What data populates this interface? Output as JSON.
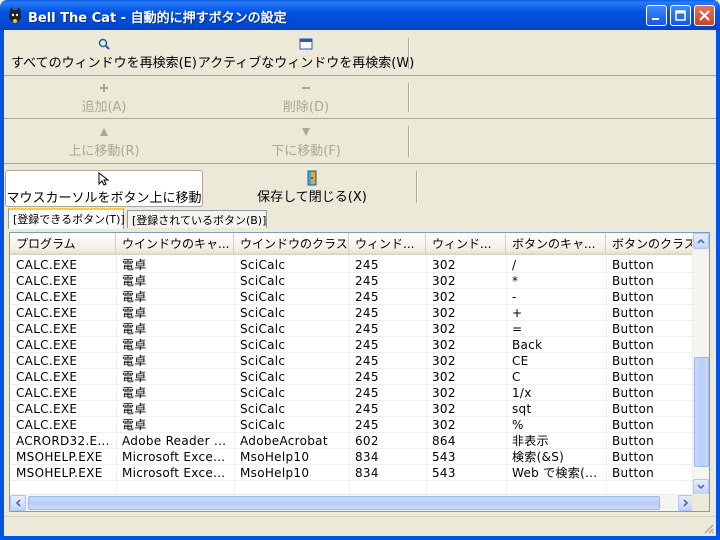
{
  "window": {
    "title": "Bell The Cat - 自動的に押すボタンの設定"
  },
  "toolbar": {
    "row1": {
      "search_all_label": "すべてのウィンドウを再検索(E)",
      "search_active_label": "アクティブなウィンドウを再検索(W)"
    },
    "row2": {
      "add_label": "追加(A)",
      "delete_label": "削除(D)"
    },
    "row3": {
      "move_up_label": "上に移動(R)",
      "move_down_label": "下に移動(F)"
    },
    "row4": {
      "move_cursor_label": "マウスカーソルをボタン上に移動",
      "save_close_label": "保存して閉じる(X)"
    }
  },
  "tabs": [
    {
      "label": "[登録できるボタン(T)]",
      "active": true
    },
    {
      "label": "[登録されているボタン(B)]",
      "active": false
    }
  ],
  "table": {
    "columns": [
      "プログラム",
      "ウインドウのキャ...",
      "ウインドウのクラス",
      "ウィンド...",
      "ウィンド...",
      "ボタンのキャ...",
      "ボタンのクラス"
    ],
    "rows": [
      [
        "CALC.EXE",
        "電卓",
        "SciCalc",
        "245",
        "302",
        "/",
        "Button"
      ],
      [
        "CALC.EXE",
        "電卓",
        "SciCalc",
        "245",
        "302",
        "*",
        "Button"
      ],
      [
        "CALC.EXE",
        "電卓",
        "SciCalc",
        "245",
        "302",
        "-",
        "Button"
      ],
      [
        "CALC.EXE",
        "電卓",
        "SciCalc",
        "245",
        "302",
        "+",
        "Button"
      ],
      [
        "CALC.EXE",
        "電卓",
        "SciCalc",
        "245",
        "302",
        "=",
        "Button"
      ],
      [
        "CALC.EXE",
        "電卓",
        "SciCalc",
        "245",
        "302",
        "Back",
        "Button"
      ],
      [
        "CALC.EXE",
        "電卓",
        "SciCalc",
        "245",
        "302",
        "CE",
        "Button"
      ],
      [
        "CALC.EXE",
        "電卓",
        "SciCalc",
        "245",
        "302",
        "C",
        "Button"
      ],
      [
        "CALC.EXE",
        "電卓",
        "SciCalc",
        "245",
        "302",
        "1/x",
        "Button"
      ],
      [
        "CALC.EXE",
        "電卓",
        "SciCalc",
        "245",
        "302",
        "sqt",
        "Button"
      ],
      [
        "CALC.EXE",
        "電卓",
        "SciCalc",
        "245",
        "302",
        "%",
        "Button"
      ],
      [
        "ACRORD32.E...",
        "Adobe Reader ...",
        "AdobeAcrobat",
        "602",
        "864",
        "非表示",
        "Button"
      ],
      [
        "MSOHELP.EXE",
        "Microsoft Exce...",
        "MsoHelp10",
        "834",
        "543",
        "検索(&S)",
        "Button"
      ],
      [
        "MSOHELP.EXE",
        "Microsoft Exce...",
        "MsoHelp10",
        "834",
        "543",
        "Web で検索(...",
        "Button"
      ]
    ],
    "vertical_scroll_position": 0.9,
    "horizontal_scroll_position": 0.0
  },
  "colors": {
    "titlebar": "#0054E3",
    "face": "#ECE9D8",
    "list_border": "#7F9DB9",
    "tab_highlight": "#FFC83C"
  }
}
